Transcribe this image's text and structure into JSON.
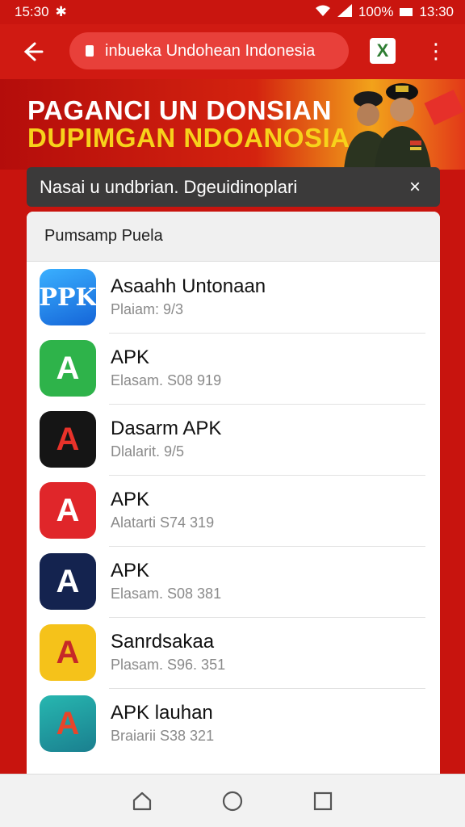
{
  "status": {
    "time_left": "15:30",
    "battery": "100%",
    "time_right": "13:30"
  },
  "browser": {
    "url": "inbueka Undohean Indonesia",
    "tab_label": "X"
  },
  "banner": {
    "line1": "PAGANCI UN DONSIAN",
    "line2": "DUPIMGAN NDOANOSIA"
  },
  "toast": {
    "message": "Nasai u undbrian. Dgeuidinoplari",
    "close": "×"
  },
  "list": {
    "header": "Pumsamp Puela",
    "apps": [
      {
        "name": "Asaahh Untonaan",
        "sub": "Plaiam: 9/3",
        "icon": "ppk-icon",
        "icon_text": "PPK",
        "color": "#1e8fe8"
      },
      {
        "name": "APK",
        "sub": "Elasam. S08 919",
        "icon": "apk-green-icon",
        "icon_text": "A",
        "color": "#2eb34a"
      },
      {
        "name": "Dasarm APK",
        "sub": "Dlalarit. 9/5",
        "icon": "apk-black-icon",
        "icon_text": "A",
        "color": "#151515"
      },
      {
        "name": "APK",
        "sub": "Alatarti S74 319",
        "icon": "apk-red-icon",
        "icon_text": "A",
        "color": "#e0262a"
      },
      {
        "name": "APK",
        "sub": "Elasam. S08 381",
        "icon": "apk-navy-icon",
        "icon_text": "A",
        "color": "#14234f"
      },
      {
        "name": "Sanrdsakaa",
        "sub": "Plasam. S96. 351",
        "icon": "apk-yellow-icon",
        "icon_text": "A",
        "color": "#f5c21a"
      },
      {
        "name": "APK lauhan",
        "sub": "Braiarii S38 321",
        "icon": "apk-teal-icon",
        "icon_text": "A",
        "color": "#1fa6a8"
      }
    ]
  }
}
